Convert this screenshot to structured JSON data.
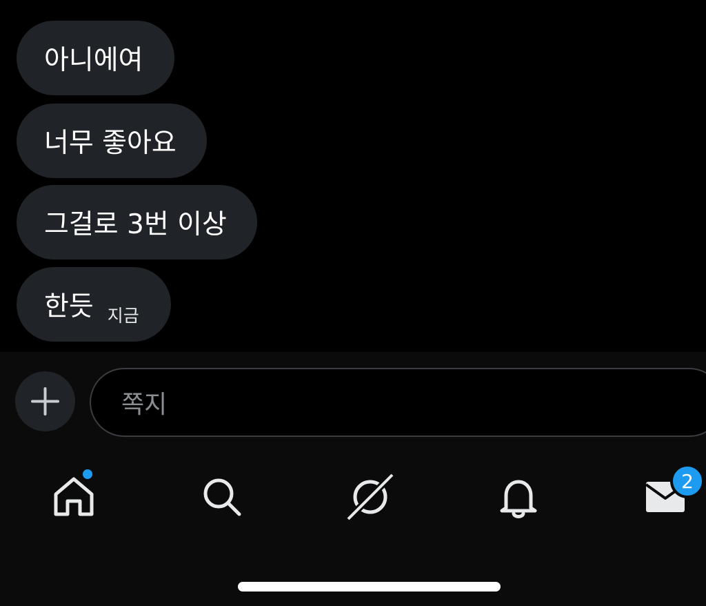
{
  "messages": [
    {
      "text": "아니에여"
    },
    {
      "text": "너무 좋아요"
    },
    {
      "text": "그걸로 3번 이상"
    },
    {
      "text": "한듯",
      "time": "지금"
    }
  ],
  "composer": {
    "placeholder": "쪽지",
    "add_icon": "plus-icon"
  },
  "tabbar": {
    "items": [
      {
        "name": "home",
        "icon": "home-icon",
        "has_dot": true
      },
      {
        "name": "search",
        "icon": "search-icon"
      },
      {
        "name": "grok",
        "icon": "grok-icon"
      },
      {
        "name": "notifications",
        "icon": "bell-icon"
      },
      {
        "name": "messages",
        "icon": "envelope-icon",
        "badge": "2"
      }
    ]
  },
  "colors": {
    "accent": "#1d9bf0",
    "bubble": "#202327",
    "background": "#000000"
  }
}
